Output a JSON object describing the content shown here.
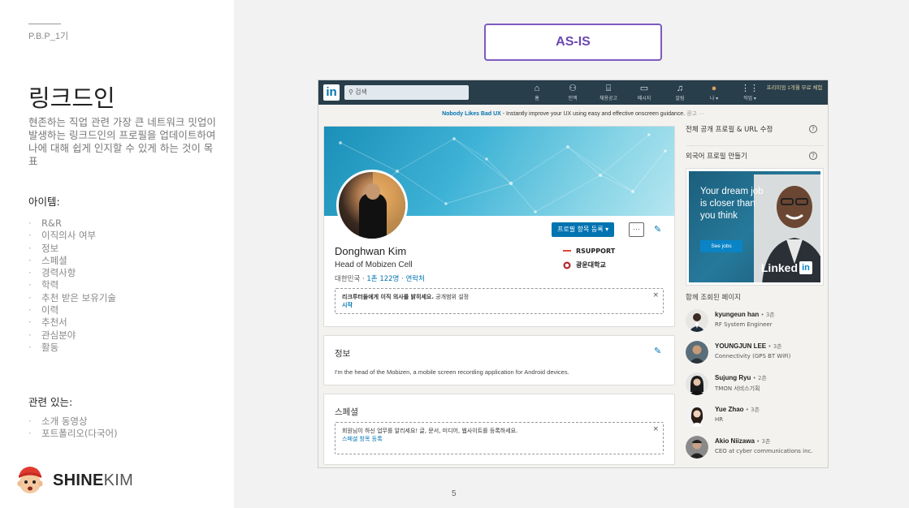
{
  "slide": {
    "course": "P.B.P_1기",
    "title": "링크드인",
    "description": "현존하는 직업 관련 가장 큰 네트워크 밋업이 발생하는 링크드인의 프로필을 업데이트하여 나에 대해 쉽게 인지할 수 있게 하는 것이 목표",
    "items_heading": "아이템:",
    "items": [
      "R&R",
      "이직의사 여부",
      "정보",
      "스페셜",
      "경력사항",
      "학력",
      "추천 받은 보유기술",
      "이력",
      "추천서",
      "관심분야",
      "활동"
    ],
    "related_heading": "관련 있는:",
    "related": [
      "소개 동영상",
      "포트폴리오(다국어)"
    ],
    "logo_bold": "SHINE",
    "logo_light": "KIM",
    "asis_label": "AS-IS",
    "page_number": "5"
  },
  "linkedin": {
    "logo": "in",
    "search_placeholder": "검색",
    "nav": [
      {
        "icon": "home-icon",
        "glyph": "⌂",
        "label": "홈"
      },
      {
        "icon": "network-icon",
        "glyph": "⚇",
        "label": "인맥"
      },
      {
        "icon": "jobs-icon",
        "glyph": "⌸",
        "label": "채용공고"
      },
      {
        "icon": "messaging-icon",
        "glyph": "▭",
        "label": "메시지"
      },
      {
        "icon": "notifications-icon",
        "glyph": "♫",
        "label": "알림"
      },
      {
        "icon": "me-icon",
        "glyph": "●",
        "label": "나 ▾"
      },
      {
        "icon": "work-icon",
        "glyph": "⋮⋮",
        "label": "작업 ▾"
      }
    ],
    "premium": "프리미엄 1개월 무료 체험",
    "banner_bold": "Nobody Likes Bad UX",
    "banner_text": " - Instantly improve your UX using easy and effective onscreen guidance.",
    "banner_ad": "광고 ···",
    "profile": {
      "add_section_button": "프로필 항목 등록 ▾",
      "more_button": "···",
      "name": "Donghwan Kim",
      "headline": "Head of Mobizen Cell",
      "location": "대한민국",
      "connections": "1촌 122명",
      "contact": "연락처",
      "companies": [
        "RSUPPORT",
        "광운대학교"
      ],
      "recruiter_text": "리크루터들에게 이직 의사를 밝히세요.",
      "recruiter_suffix": " 공개범위 설정",
      "recruiter_link": "시작",
      "close": "×"
    },
    "about": {
      "title": "정보",
      "text": "I'm the head of the Mobizen, a mobile screen recording application for Android devices."
    },
    "featured": {
      "title": "스페셜",
      "text": "회원님이 하신 업무를 알리세요! 글, 문서, 미디어, 웹사이트를 등록하세요.",
      "link": "스페셜 항목 등록",
      "close": "×"
    },
    "sidebar": {
      "public_profile": "전체 공개 프로필 & URL 수정",
      "other_language": "외국어 프로필 만들기",
      "help": "?",
      "ad_text": "Your dream job is closer than you think",
      "ad_button": "See jobs",
      "ad_brand": "Linked",
      "ad_brand_in": "in",
      "people_also_viewed": "함께 조회된 페이지",
      "people": [
        {
          "name": "kyungeun han",
          "degree": " • 3촌",
          "title": "RF System Engineer"
        },
        {
          "name": "YOUNGJUN LEE",
          "degree": " • 3촌",
          "title": "Connectivity (GPS BT WiFi)"
        },
        {
          "name": "Sujung Ryu",
          "degree": " • 2촌",
          "title": "TMON 서비스기획"
        },
        {
          "name": "Yue Zhao",
          "degree": " • 3촌",
          "title": "HR"
        },
        {
          "name": "Akio Niizawa",
          "degree": " • 3촌",
          "title": "CEO at cyber communications inc."
        }
      ]
    }
  },
  "colors": {
    "accent_purple": "#7d5bbe",
    "linkedin_blue": "#0073b1",
    "linkedin_nav": "#283e4a"
  }
}
